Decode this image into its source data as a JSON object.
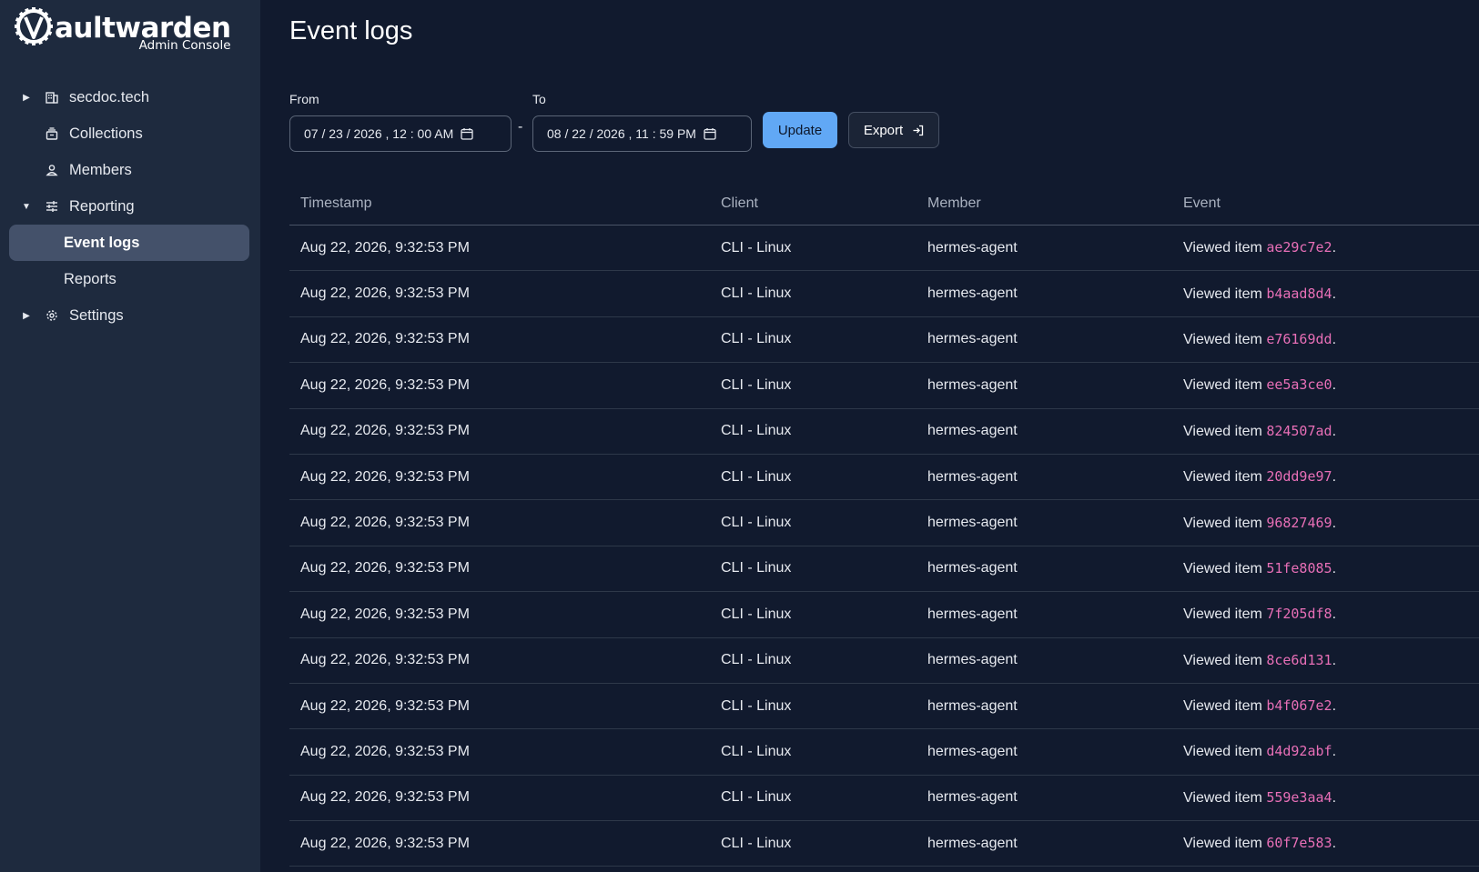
{
  "brand": {
    "name_bold": "aultwarden",
    "subtitle": "Admin Console"
  },
  "sidebar": {
    "items": [
      {
        "label": "secdoc.tech",
        "icon": "building-icon",
        "caret": "right"
      },
      {
        "label": "Collections",
        "icon": "collection-icon"
      },
      {
        "label": "Members",
        "icon": "user-icon"
      },
      {
        "label": "Reporting",
        "icon": "sliders-icon",
        "caret": "down"
      },
      {
        "label": "Event logs",
        "active": true
      },
      {
        "label": "Reports"
      },
      {
        "label": "Settings",
        "icon": "gear-icon",
        "caret": "right"
      }
    ]
  },
  "page": {
    "title": "Event logs"
  },
  "filters": {
    "from_label": "From",
    "from_value": "07 / 23 / 2026 ,  12 : 00   AM",
    "separator": "-",
    "to_label": "To",
    "to_value": "08 / 22 / 2026 ,  11 : 59   PM",
    "update_label": "Update",
    "export_label": "Export"
  },
  "table": {
    "headers": [
      "Timestamp",
      "Client",
      "Member",
      "Event"
    ],
    "event_prefix": "Viewed item ",
    "rows": [
      {
        "timestamp": "Aug 22, 2026, 9:32:53 PM",
        "client": "CLI - Linux",
        "member": "hermes-agent",
        "item": "ae29c7e2"
      },
      {
        "timestamp": "Aug 22, 2026, 9:32:53 PM",
        "client": "CLI - Linux",
        "member": "hermes-agent",
        "item": "b4aad8d4"
      },
      {
        "timestamp": "Aug 22, 2026, 9:32:53 PM",
        "client": "CLI - Linux",
        "member": "hermes-agent",
        "item": "e76169dd"
      },
      {
        "timestamp": "Aug 22, 2026, 9:32:53 PM",
        "client": "CLI - Linux",
        "member": "hermes-agent",
        "item": "ee5a3ce0"
      },
      {
        "timestamp": "Aug 22, 2026, 9:32:53 PM",
        "client": "CLI - Linux",
        "member": "hermes-agent",
        "item": "824507ad"
      },
      {
        "timestamp": "Aug 22, 2026, 9:32:53 PM",
        "client": "CLI - Linux",
        "member": "hermes-agent",
        "item": "20dd9e97"
      },
      {
        "timestamp": "Aug 22, 2026, 9:32:53 PM",
        "client": "CLI - Linux",
        "member": "hermes-agent",
        "item": "96827469"
      },
      {
        "timestamp": "Aug 22, 2026, 9:32:53 PM",
        "client": "CLI - Linux",
        "member": "hermes-agent",
        "item": "51fe8085"
      },
      {
        "timestamp": "Aug 22, 2026, 9:32:53 PM",
        "client": "CLI - Linux",
        "member": "hermes-agent",
        "item": "7f205df8"
      },
      {
        "timestamp": "Aug 22, 2026, 9:32:53 PM",
        "client": "CLI - Linux",
        "member": "hermes-agent",
        "item": "8ce6d131"
      },
      {
        "timestamp": "Aug 22, 2026, 9:32:53 PM",
        "client": "CLI - Linux",
        "member": "hermes-agent",
        "item": "b4f067e2"
      },
      {
        "timestamp": "Aug 22, 2026, 9:32:53 PM",
        "client": "CLI - Linux",
        "member": "hermes-agent",
        "item": "d4d92abf"
      },
      {
        "timestamp": "Aug 22, 2026, 9:32:53 PM",
        "client": "CLI - Linux",
        "member": "hermes-agent",
        "item": "559e3aa4"
      },
      {
        "timestamp": "Aug 22, 2026, 9:32:53 PM",
        "client": "CLI - Linux",
        "member": "hermes-agent",
        "item": "60f7e583"
      }
    ]
  },
  "colors": {
    "accent": "#61a8f5",
    "item_id": "#e86fb7",
    "sidebar_bg": "#1e2a3e",
    "main_bg": "#111a2e"
  }
}
